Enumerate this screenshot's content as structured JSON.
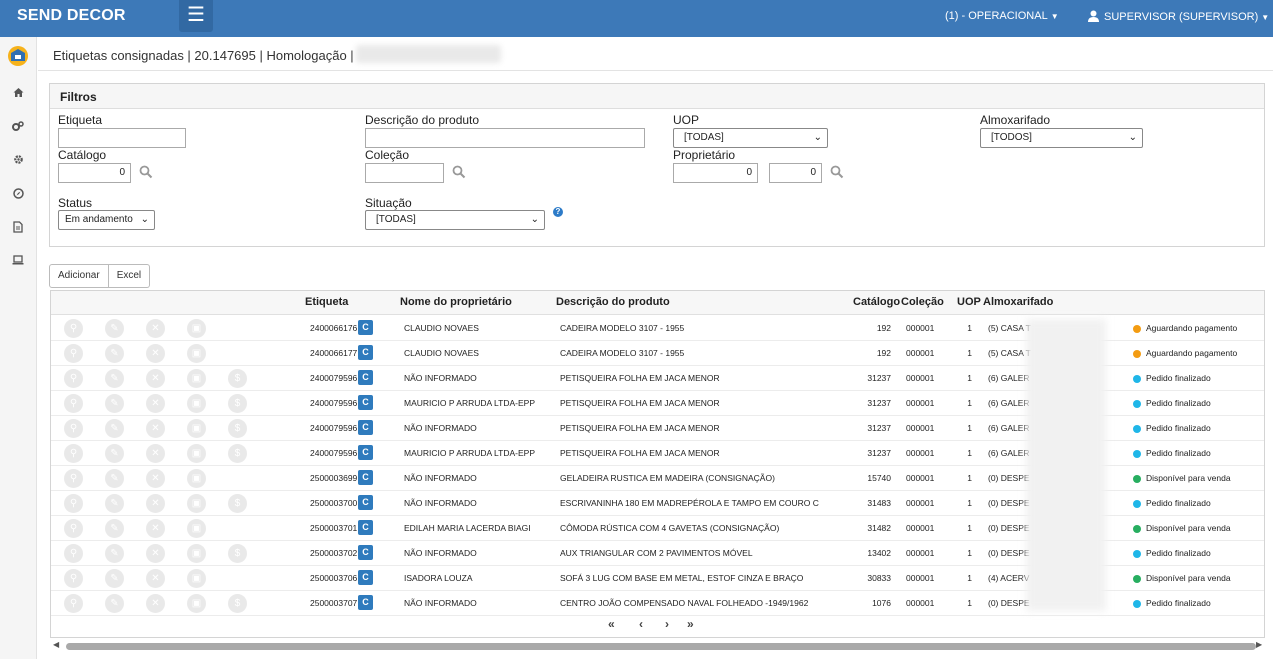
{
  "app": {
    "brand": "SEND DECOR",
    "context_menu": "(1) - OPERACIONAL",
    "user_menu": "SUPERVISOR (SUPERVISOR)"
  },
  "breadcrumb": "Etiquetas consignadas | 20.147695 | Homologação |",
  "filters": {
    "title": "Filtros",
    "etiqueta_label": "Etiqueta",
    "descricao_label": "Descrição do produto",
    "uop_label": "UOP",
    "uop_value": "[TODAS]",
    "almox_label": "Almoxarifado",
    "almox_value": "[TODOS]",
    "catalogo_label": "Catálogo",
    "catalogo_value": "0",
    "colecao_label": "Coleção",
    "proprietario_label": "Proprietário",
    "proprietario_value1": "0",
    "proprietario_value2": "0",
    "status_label": "Status",
    "status_value": "Em andamento",
    "situacao_label": "Situação",
    "situacao_value": "[TODAS]"
  },
  "toolbar": {
    "add_label": "Adicionar",
    "excel_label": "Excel"
  },
  "grid": {
    "headers": {
      "etiqueta": "Etiqueta",
      "proprietario": "Nome do proprietário",
      "descricao": "Descrição do produto",
      "catalogo": "Catálogo",
      "colecao": "Coleção",
      "uop": "UOP",
      "almoxarifado": "Almoxarifado"
    },
    "badge_letter": "C",
    "rows": [
      {
        "etiqueta": "2400066176",
        "proprietario": "CLAUDIO NOVAES",
        "descricao": "CADEIRA MODELO 3107 - 1955",
        "catalogo": "192",
        "colecao": "000001",
        "uop": "1",
        "almox": "(5) CASA T",
        "status": "Aguardando pagamento",
        "status_color": "#f39c12",
        "extra_icon": false
      },
      {
        "etiqueta": "2400066177",
        "proprietario": "CLAUDIO NOVAES",
        "descricao": "CADEIRA MODELO 3107 - 1955",
        "catalogo": "192",
        "colecao": "000001",
        "uop": "1",
        "almox": "(5) CASA T",
        "status": "Aguardando pagamento",
        "status_color": "#f39c12",
        "extra_icon": false
      },
      {
        "etiqueta": "2400079596",
        "proprietario": "NÃO INFORMADO",
        "descricao": "PETISQUEIRA FOLHA EM JACA MENOR",
        "catalogo": "31237",
        "colecao": "000001",
        "uop": "1",
        "almox": "(6) GALER",
        "status": "Pedido finalizado",
        "status_color": "#1fb6e8",
        "extra_icon": true
      },
      {
        "etiqueta": "2400079596",
        "proprietario": "MAURICIO P ARRUDA LTDA-EPP",
        "descricao": "PETISQUEIRA FOLHA EM JACA MENOR",
        "catalogo": "31237",
        "colecao": "000001",
        "uop": "1",
        "almox": "(6) GALER",
        "status": "Pedido finalizado",
        "status_color": "#1fb6e8",
        "extra_icon": true
      },
      {
        "etiqueta": "2400079596",
        "proprietario": "NÃO INFORMADO",
        "descricao": "PETISQUEIRA FOLHA EM JACA MENOR",
        "catalogo": "31237",
        "colecao": "000001",
        "uop": "1",
        "almox": "(6) GALER",
        "status": "Pedido finalizado",
        "status_color": "#1fb6e8",
        "extra_icon": true
      },
      {
        "etiqueta": "2400079596",
        "proprietario": "MAURICIO P ARRUDA LTDA-EPP",
        "descricao": "PETISQUEIRA FOLHA EM JACA MENOR",
        "catalogo": "31237",
        "colecao": "000001",
        "uop": "1",
        "almox": "(6) GALER",
        "status": "Pedido finalizado",
        "status_color": "#1fb6e8",
        "extra_icon": true
      },
      {
        "etiqueta": "2500003699",
        "proprietario": "NÃO INFORMADO",
        "descricao": "GELADEIRA RUSTICA EM MADEIRA (CONSIGNAÇÃO)",
        "catalogo": "15740",
        "colecao": "000001",
        "uop": "1",
        "almox": "(0) DESPE",
        "status": "Disponível para venda",
        "status_color": "#27ae60",
        "extra_icon": false
      },
      {
        "etiqueta": "2500003700",
        "proprietario": "NÃO INFORMADO",
        "descricao": "ESCRIVANINHA 180 EM MADREPÉROLA E TAMPO EM COURO C",
        "catalogo": "31483",
        "colecao": "000001",
        "uop": "1",
        "almox": "(0) DESPE",
        "status": "Pedido finalizado",
        "status_color": "#1fb6e8",
        "extra_icon": true
      },
      {
        "etiqueta": "2500003701",
        "proprietario": "EDILAH MARIA LACERDA BIAGI",
        "descricao": "CÔMODA RÚSTICA COM 4 GAVETAS (CONSIGNAÇÃO)",
        "catalogo": "31482",
        "colecao": "000001",
        "uop": "1",
        "almox": "(0) DESPE",
        "status": "Disponível para venda",
        "status_color": "#27ae60",
        "extra_icon": false
      },
      {
        "etiqueta": "2500003702",
        "proprietario": "NÃO INFORMADO",
        "descricao": "AUX TRIANGULAR COM 2 PAVIMENTOS MÓVEL",
        "catalogo": "13402",
        "colecao": "000001",
        "uop": "1",
        "almox": "(0) DESPE",
        "status": "Pedido finalizado",
        "status_color": "#1fb6e8",
        "extra_icon": true
      },
      {
        "etiqueta": "2500003706",
        "proprietario": "ISADORA LOUZA",
        "descricao": "SOFÁ 3 LUG COM BASE EM METAL, ESTOF CINZA E BRAÇO",
        "catalogo": "30833",
        "colecao": "000001",
        "uop": "1",
        "almox": "(4) ACERV",
        "status": "Disponível para venda",
        "status_color": "#27ae60",
        "extra_icon": false
      },
      {
        "etiqueta": "2500003707",
        "proprietario": "NÃO INFORMADO",
        "descricao": "CENTRO JOÃO COMPENSADO NAVAL FOLHEADO -1949/1962",
        "catalogo": "1076",
        "colecao": "000001",
        "uop": "1",
        "almox": "(0) DESPE",
        "status": "Pedido finalizado",
        "status_color": "#1fb6e8",
        "extra_icon": true
      }
    ]
  },
  "pager": {
    "first": "«",
    "prev": "‹",
    "next": "›",
    "last": "»"
  },
  "colors": {
    "topbar": "#3d79b8",
    "accent": "#2f7bbd"
  }
}
